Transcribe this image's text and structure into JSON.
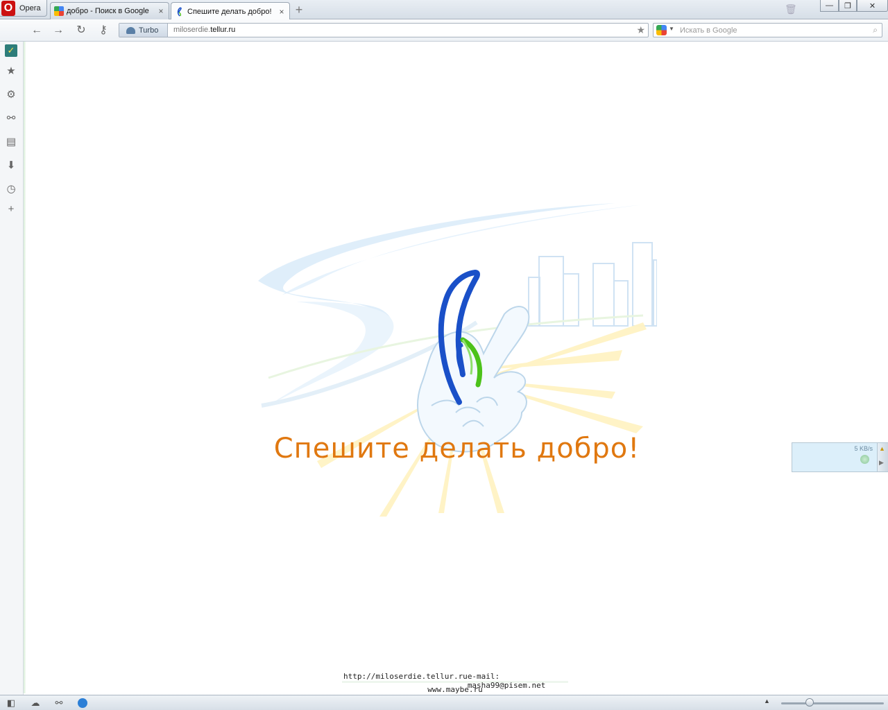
{
  "browser": {
    "menu_label": "Opera",
    "tabs": [
      {
        "title": "добро - Поиск в Google",
        "close": "×"
      },
      {
        "title": "Спешите делать добро!",
        "close": "×"
      }
    ],
    "new_tab": "+",
    "window_controls": {
      "minimize": "—",
      "restore": "❐",
      "close": "✕"
    }
  },
  "toolbar": {
    "turbo_label": "Turbo",
    "url_prefix": "miloserdie.",
    "url_domain": "tellur.ru",
    "search_placeholder": "Искать в Google"
  },
  "page": {
    "tagline": "Спешите делать добро!",
    "footer": {
      "site": "http://miloserdie.tellur.ru",
      "email": "e-mail: masha99@pisem.net",
      "sub": "www.maybe.ru"
    }
  },
  "transfer": {
    "rate": "5 KB/s"
  },
  "colors": {
    "tagline": "#e07810",
    "clef_blue": "#1a50c8",
    "clef_green": "#4cc21a",
    "panel_bg": "#f4f6f8"
  },
  "icons": {
    "sidebar": [
      "check-icon",
      "star-icon",
      "gear-icon",
      "share-icon",
      "note-icon",
      "download-icon",
      "clock-icon",
      "plus-icon"
    ],
    "status": [
      "panel-toggle-icon",
      "cloud-icon",
      "share-icon",
      "speed-dial-icon"
    ]
  }
}
